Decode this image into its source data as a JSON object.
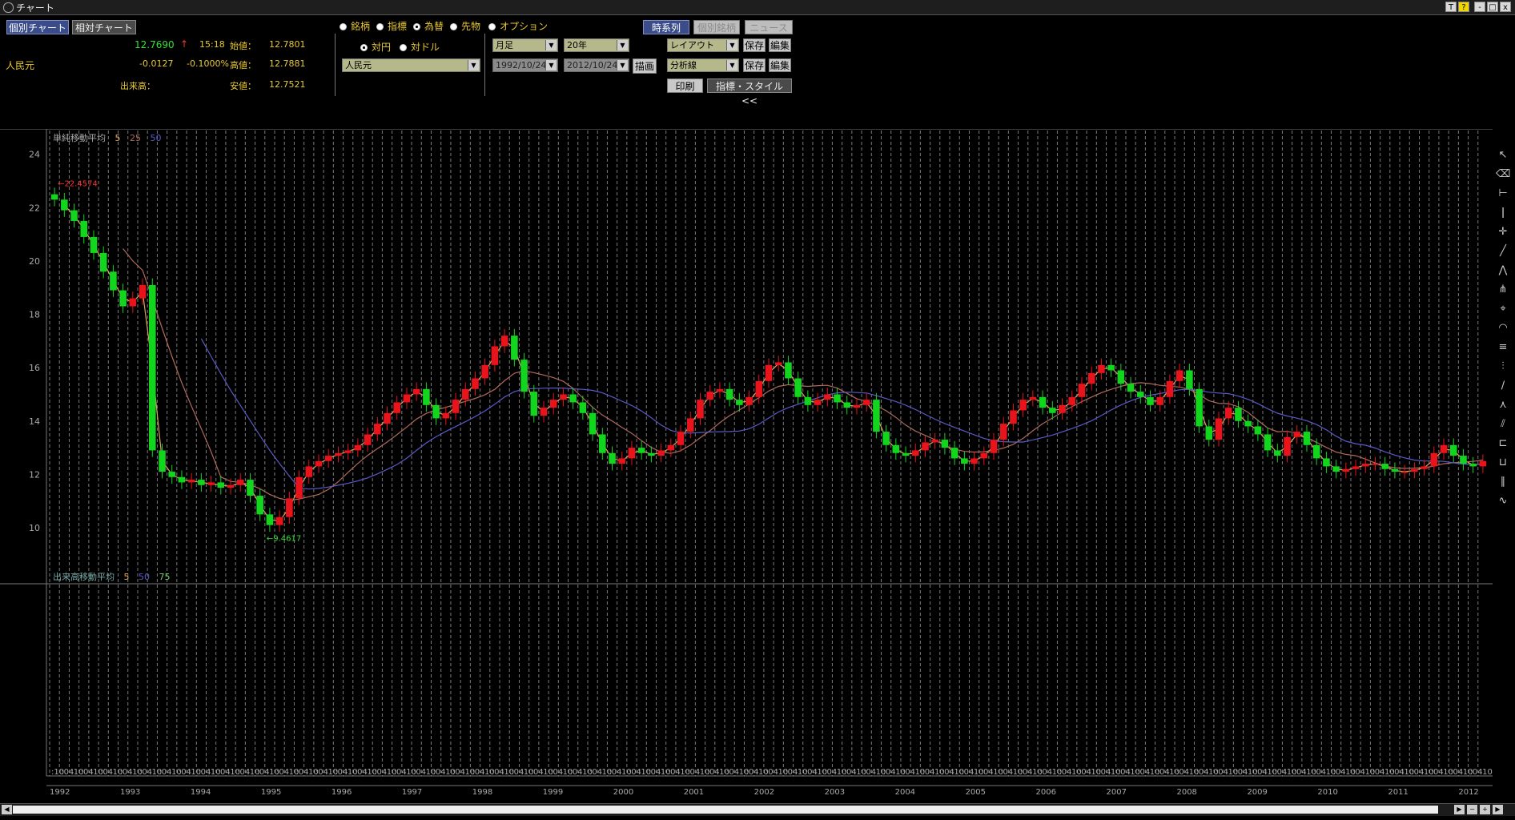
{
  "window": {
    "title": "チャート",
    "buttons": [
      "T",
      "?",
      "-",
      "□",
      "x"
    ]
  },
  "tabs": {
    "individual": "個別チャート",
    "relative": "相対チャート"
  },
  "quote": {
    "name": "人民元",
    "price": "12.7690",
    "arrow": "↑",
    "time": "15:18",
    "change": "-0.0127",
    "change_pct": "-0.1000%",
    "open_label": "始値：",
    "open": "12.7801",
    "high_label": "高値：",
    "high": "12.7881",
    "low_label": "安値：",
    "low": "12.7521",
    "volume_label": "出来高："
  },
  "type_radios": [
    {
      "label": "銘柄",
      "checked": false
    },
    {
      "label": "指標",
      "checked": false
    },
    {
      "label": "為替",
      "checked": true
    },
    {
      "label": "先物",
      "checked": false
    },
    {
      "label": "オプション",
      "checked": false
    }
  ],
  "currency_radios": [
    {
      "label": "対円",
      "checked": true
    },
    {
      "label": "対ドル",
      "checked": false
    }
  ],
  "currency_select": "人民元",
  "period": {
    "interval": "月足",
    "span": "20年",
    "from": "1992/10/24",
    "to": "2012/10/24",
    "draw": "描画"
  },
  "right_buttons": {
    "timeseries": "時系列",
    "individual_issue": "個別銘柄",
    "news": "ニュース",
    "layout": "レイアウト",
    "analysis": "分析線",
    "save": "保存",
    "edit": "編集",
    "print": "印刷",
    "indicator_style": "指標・スタイル<<"
  },
  "colors": {
    "up": "#e8131b",
    "down": "#12d61e",
    "ma5": "#d9a55a",
    "ma25": "#b06a5a",
    "ma50": "#5a5ac8",
    "grid": "#888888"
  },
  "toolbar_icons": [
    "cursor-icon",
    "eraser-icon",
    "horizontal-line-icon",
    "vertical-line-icon",
    "crosshair-icon",
    "trend-line-icon",
    "fan-line-icon",
    "pitchfork-icon",
    "fibonacci-fan-icon",
    "fibonacci-arc-icon",
    "fibonacci-retracement-icon",
    "fibonacci-time-icon",
    "regression-line-icon",
    "gann-fan-icon",
    "channel-icon",
    "bracket-icon",
    "cycle-icon",
    "parallel-lines-icon",
    "wave-icon"
  ],
  "chart_data": {
    "type": "candlestick",
    "price_legend": {
      "label": "単純移動平均",
      "periods": [
        "5",
        "25",
        "50"
      ]
    },
    "volume_legend": {
      "label": "出来高移動平均",
      "periods": [
        "5",
        "50",
        "75"
      ]
    },
    "y_ticks": [
      "24",
      "22",
      "20",
      "18",
      "16",
      "14",
      "12",
      "10"
    ],
    "ylim": [
      8.5,
      24.5
    ],
    "high_marker": "←22.4574",
    "low_marker": "←9.4617",
    "years": [
      "1992",
      "1993",
      "1994",
      "1995",
      "1996",
      "1997",
      "1998",
      "1999",
      "2000",
      "2001",
      "2002",
      "2003",
      "2004",
      "2005",
      "2006",
      "2007",
      "2008",
      "2009",
      "2010",
      "2011",
      "2012"
    ],
    "month_ticks": [
      "10",
      "04"
    ],
    "closes": [
      22.3,
      21.9,
      21.5,
      20.9,
      20.3,
      19.6,
      18.9,
      18.3,
      18.6,
      19.1,
      12.9,
      12.1,
      11.9,
      11.7,
      11.8,
      11.6,
      11.7,
      11.5,
      11.6,
      11.8,
      11.2,
      10.5,
      10.1,
      10.4,
      11.1,
      11.9,
      12.3,
      12.5,
      12.7,
      12.8,
      12.9,
      13.1,
      13.5,
      13.9,
      14.3,
      14.7,
      15.0,
      15.2,
      14.6,
      14.1,
      14.3,
      14.8,
      15.2,
      15.6,
      16.1,
      16.8,
      17.2,
      16.3,
      15.1,
      14.2,
      14.5,
      14.8,
      15.0,
      14.7,
      14.3,
      13.5,
      12.8,
      12.4,
      12.6,
      13.0,
      12.8,
      12.7,
      12.9,
      13.1,
      13.6,
      14.1,
      14.8,
      15.1,
      15.2,
      14.8,
      14.6,
      14.9,
      15.5,
      16.1,
      16.2,
      15.6,
      14.9,
      14.6,
      14.8,
      15.0,
      14.7,
      14.5,
      14.6,
      14.8,
      13.6,
      13.1,
      12.8,
      12.7,
      12.9,
      13.2,
      13.3,
      13.0,
      12.6,
      12.4,
      12.6,
      12.8,
      13.3,
      13.9,
      14.4,
      14.8,
      14.9,
      14.5,
      14.3,
      14.6,
      14.9,
      15.4,
      15.8,
      16.1,
      15.9,
      15.4,
      15.1,
      14.9,
      14.6,
      14.9,
      15.5,
      15.9,
      15.2,
      13.8,
      13.3,
      14.1,
      14.5,
      14.0,
      13.8,
      13.5,
      12.9,
      12.7,
      13.4,
      13.6,
      13.1,
      12.6,
      12.3,
      12.1,
      12.2,
      12.3,
      12.4,
      12.4,
      12.2,
      12.1,
      12.1,
      12.2,
      12.3,
      12.8,
      13.1,
      12.7,
      12.4,
      12.3,
      12.5
    ]
  }
}
